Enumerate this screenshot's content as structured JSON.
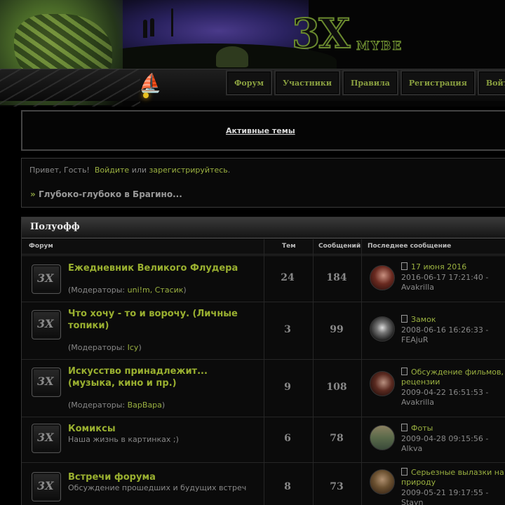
{
  "header": {
    "logo_main": "3X",
    "logo_sub": "MYBE"
  },
  "nav": [
    {
      "label": "Форум"
    },
    {
      "label": "Участники"
    },
    {
      "label": "Правила"
    },
    {
      "label": "Регистрация"
    },
    {
      "label": "Войти"
    }
  ],
  "active_topics": "Активные темы",
  "welcome": {
    "greeting": "Привет, Гость!",
    "login": "Войдите",
    "or": "или",
    "register": "зарегистрируйтесь",
    "period": "."
  },
  "breadcrumb": {
    "arrow": "»",
    "text": "Глубоко-глубоко в Брагино..."
  },
  "category": {
    "title": "Полуофф",
    "columns": {
      "forum": "Форум",
      "topics": "Тем",
      "posts": "Сообщений",
      "last": "Последнее сообщение"
    },
    "forums": [
      {
        "name": "Ежедневник Великого Флудера",
        "desc_prefix": "(Модераторы: ",
        "mods": "uni!m, Стасик",
        "desc_suffix": ")",
        "topics": "24",
        "posts": "184",
        "last_title": "17 июня 2016",
        "last_date": "2016-06-17 17:21:40 -",
        "last_user": "Avakrilla"
      },
      {
        "name": "Что хочу - то и ворочу. (Личные топики)",
        "desc_prefix": "(Модераторы: ",
        "mods": "Icy",
        "desc_suffix": ")",
        "topics": "3",
        "posts": "99",
        "last_title": "Замок",
        "last_date": "2008-06-16 16:26:33 -",
        "last_user": "FEAjuR"
      },
      {
        "name": "Искусство принадлежит... (музыка, кино и пр.)",
        "desc_prefix": "(Модераторы: ",
        "mods": "ВарВара",
        "desc_suffix": ")",
        "topics": "9",
        "posts": "108",
        "last_title": "Обсуждение фильмов, рецензии",
        "last_date": "2009-04-22 16:51:53 -",
        "last_user": "Avakrilla"
      },
      {
        "name": "Комиксы",
        "desc": "Наша жизнь в картинках ;)",
        "topics": "6",
        "posts": "78",
        "last_title": "Фоты",
        "last_date": "2009-04-28 09:15:56 -",
        "last_user": "Alkva"
      },
      {
        "name": "Встречи форума",
        "desc": "Обсуждение прошедших и будущих встреч",
        "topics": "8",
        "posts": "73",
        "last_title": "Серьезные вылазки на природу",
        "last_date": "2009-05-21 19:17:55 -",
        "last_user": "Stayn"
      }
    ]
  },
  "colors": {
    "accent": "#9ab030",
    "text_muted": "#888888",
    "background": "#000000"
  }
}
